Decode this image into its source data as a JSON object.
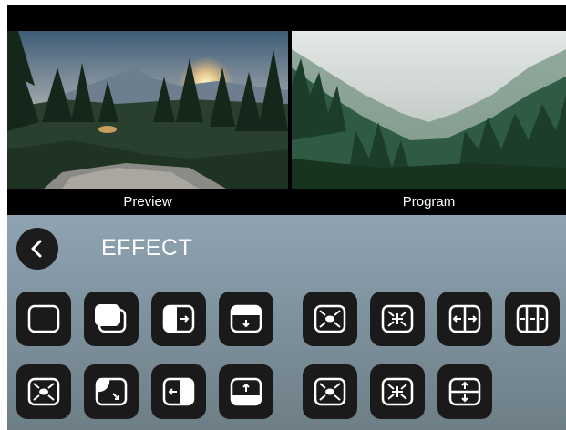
{
  "monitors": {
    "preview_label": "Preview",
    "program_label": "Program"
  },
  "panel": {
    "title": "EFFECT",
    "back_icon": "chevron-left-icon"
  },
  "effects_row1": [
    {
      "icon": "rounded-square-icon"
    },
    {
      "icon": "overlap-squares-icon"
    },
    {
      "icon": "wipe-right-icon"
    },
    {
      "icon": "wipe-down-icon"
    },
    {
      "icon": "zoom-in-center-icon"
    },
    {
      "icon": "zoom-out-center-icon"
    },
    {
      "icon": "split-horizontal-out-icon"
    },
    {
      "icon": "split-vertical-triple-icon"
    }
  ],
  "effects_row2": [
    {
      "icon": "zoom-in-corners-icon"
    },
    {
      "icon": "corner-circle-wipe-icon"
    },
    {
      "icon": "wipe-left-icon"
    },
    {
      "icon": "wipe-up-icon"
    },
    {
      "icon": "zoom-in-center-alt-icon"
    },
    {
      "icon": "zoom-out-center-alt-icon"
    },
    {
      "icon": "split-vertical-out-icon"
    }
  ]
}
